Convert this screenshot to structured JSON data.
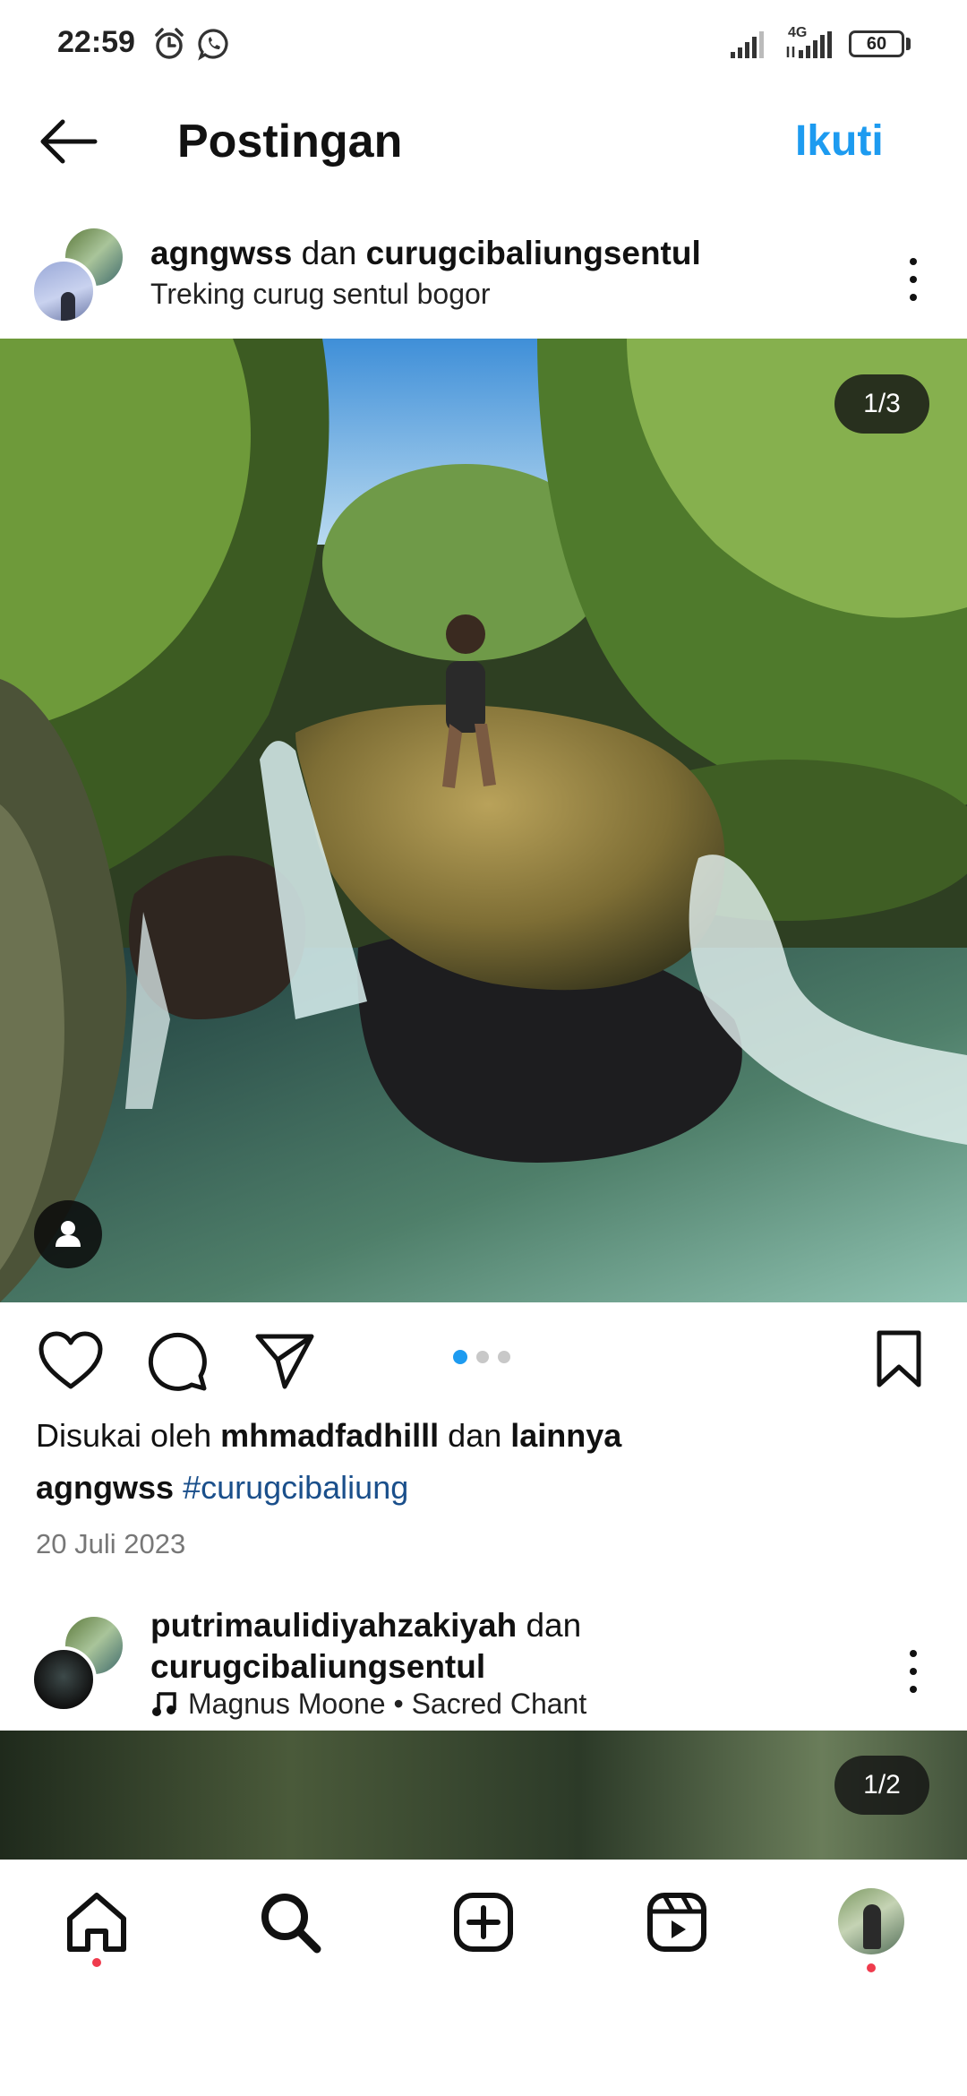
{
  "status_bar": {
    "time": "22:59",
    "network": "4G",
    "battery": "60",
    "icons": [
      "alarm-icon",
      "whatsapp-icon",
      "signal-icon",
      "signal-4g-icon",
      "battery-icon"
    ]
  },
  "header": {
    "title": "Postingan",
    "follow_label": "Ikuti",
    "accent_color": "#1d9bf0"
  },
  "post": {
    "user1": "agngwss",
    "conjunction": "dan",
    "user2": "curugcibaliungsentul",
    "location": "Treking curug sentul bogor",
    "photo_counter": "1/3",
    "carousel_index": 1,
    "carousel_total": 3,
    "liked_by_prefix": "Disukai oleh",
    "liked_by_user": "mhmadfadhilll",
    "liked_by_and": "dan",
    "liked_by_others": "lainnya",
    "caption_user": "agngwss",
    "caption_hashtag": "#curugcibaliung",
    "date": "20 Juli 2023"
  },
  "next_post": {
    "user1": "putrimaulidiyahzakiyah",
    "conjunction": "dan",
    "user2": "curugcibaliungsentul",
    "music": "Magnus Moone • Sacred Chant",
    "photo_counter": "1/2"
  },
  "bottom_nav": {
    "items": [
      "home-icon",
      "search-icon",
      "create-icon",
      "reels-icon",
      "profile-avatar"
    ],
    "notification_color": "#ef3b4d"
  }
}
